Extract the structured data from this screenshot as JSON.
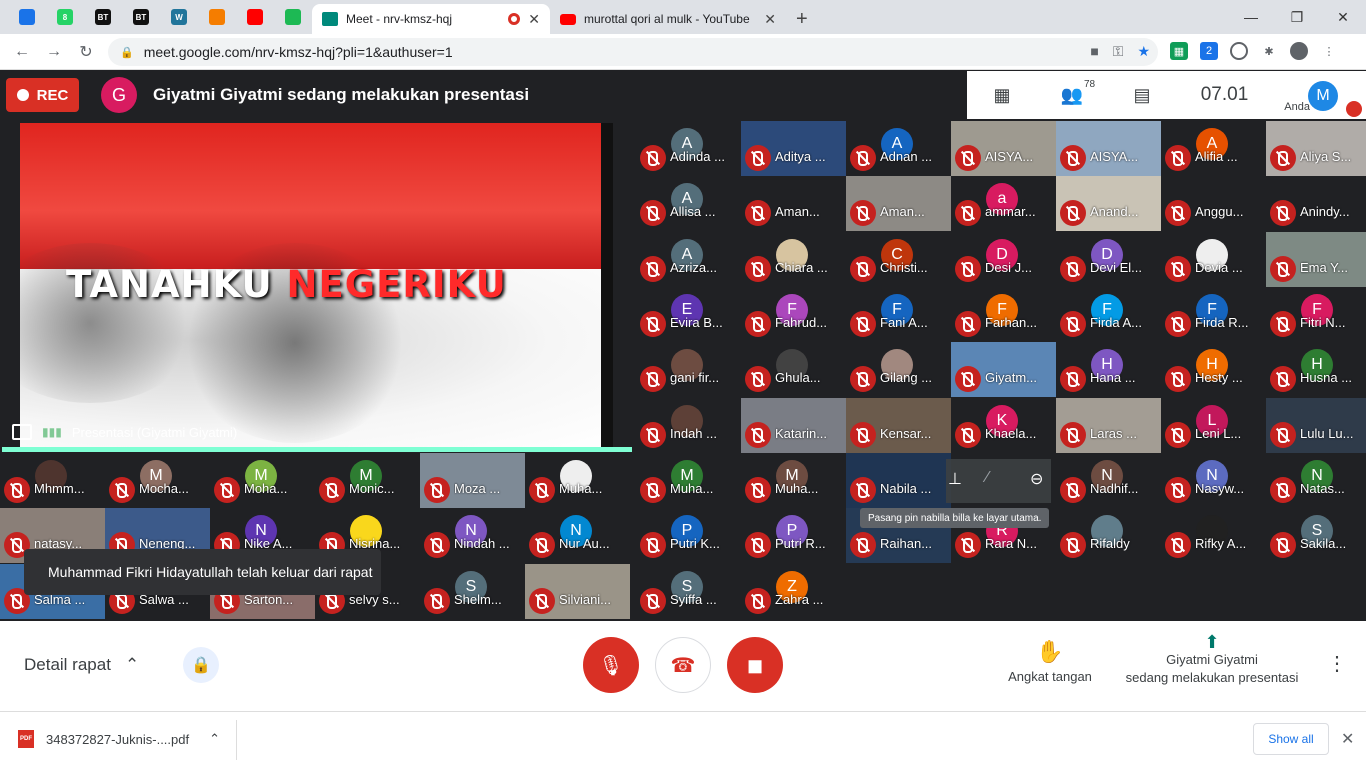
{
  "browser": {
    "pinned_tabs": [
      {
        "icon": "kemdikbud-icon",
        "color": "#1a73e8",
        "label": ""
      },
      {
        "icon": "whatsapp-icon",
        "color": "#25d366",
        "label": "8"
      },
      {
        "icon": "bt-icon",
        "color": "#111111",
        "label": "BT"
      },
      {
        "icon": "bt-icon",
        "color": "#111111",
        "label": "BT"
      },
      {
        "icon": "wordpress-icon",
        "color": "#21759b",
        "label": "W"
      },
      {
        "icon": "blogger-icon",
        "color": "#f57d00",
        "label": ""
      },
      {
        "icon": "youtube-icon",
        "color": "#ff0000",
        "label": ""
      },
      {
        "icon": "spotify-icon",
        "color": "#1db954",
        "label": ""
      }
    ],
    "active_tab_title": "Meet - nrv-kmsz-hqj",
    "second_tab_title": "murottal qori al mulk - YouTube",
    "url": "meet.google.com/nrv-kmsz-hqj?pli=1&authuser=1",
    "profile_initial": ""
  },
  "meet": {
    "rec_label": "REC",
    "presenter_initial": "G",
    "presenter_text": "Giyatmi Giyatmi sedang melakukan presentasi",
    "participant_count": "78",
    "clock": "07.01",
    "me_initial": "M",
    "me_label": "Anda",
    "slide_word1": "TANAHKU",
    "slide_word2": "NEGERIKU",
    "presentation_caption": "Presentasi (Giyatmi Giyatmi)",
    "toast": "Muhammad Fikri Hidayatullah telah keluar dari rapat",
    "pin_tooltip": "Pasang pin nabilla billa ke layar utama."
  },
  "participants": [
    {
      "name": "Adinda ...",
      "initial": "A",
      "color": "#546e7a",
      "bg": ""
    },
    {
      "name": "Aditya ...",
      "initial": "",
      "color": "",
      "bg": "#2c4a7a"
    },
    {
      "name": "Adnan ...",
      "initial": "A",
      "color": "#1565c0",
      "bg": ""
    },
    {
      "name": "AISYA...",
      "initial": "",
      "color": "",
      "bg": "#9e9a90"
    },
    {
      "name": "AISYA...",
      "initial": "",
      "color": "",
      "bg": "#8fa7c0"
    },
    {
      "name": "Alifia ...",
      "initial": "A",
      "color": "#e65100",
      "bg": ""
    },
    {
      "name": "Aliya S...",
      "initial": "",
      "color": "",
      "bg": "#b0aca8"
    },
    {
      "name": "Allisa ...",
      "initial": "A",
      "color": "#546e7a",
      "bg": ""
    },
    {
      "name": "Aman...",
      "initial": "",
      "color": "",
      "bg": ""
    },
    {
      "name": "Aman...",
      "initial": "",
      "color": "",
      "bg": "#8d8a85"
    },
    {
      "name": "ammar...",
      "initial": "a",
      "color": "#d81b60",
      "bg": ""
    },
    {
      "name": "Anand...",
      "initial": "",
      "color": "",
      "bg": "#c9c3b5"
    },
    {
      "name": "Anggu...",
      "initial": "",
      "color": "",
      "bg": ""
    },
    {
      "name": "Anindy...",
      "initial": "",
      "color": "",
      "bg": ""
    },
    {
      "name": "Azriza...",
      "initial": "A",
      "color": "#546e7a",
      "bg": ""
    },
    {
      "name": "Chiara ...",
      "initial": "",
      "color": "#d7c4a0",
      "bg": ""
    },
    {
      "name": "Christi...",
      "initial": "C",
      "color": "#bf360c",
      "bg": ""
    },
    {
      "name": "Desi J...",
      "initial": "D",
      "color": "#d81b60",
      "bg": ""
    },
    {
      "name": "Devi El...",
      "initial": "D",
      "color": "#7e57c2",
      "bg": ""
    },
    {
      "name": "Devia ...",
      "initial": "",
      "color": "#eeeeee",
      "bg": ""
    },
    {
      "name": "Ema Y...",
      "initial": "",
      "color": "",
      "bg": "#7e8a84"
    },
    {
      "name": "Evira B...",
      "initial": "E",
      "color": "#5e35b1",
      "bg": ""
    },
    {
      "name": "Fahrud...",
      "initial": "F",
      "color": "#ab47bc",
      "bg": ""
    },
    {
      "name": "Fani A...",
      "initial": "F",
      "color": "#1565c0",
      "bg": ""
    },
    {
      "name": "Farhan...",
      "initial": "F",
      "color": "#ef6c00",
      "bg": ""
    },
    {
      "name": "Firda A...",
      "initial": "F",
      "color": "#039be5",
      "bg": ""
    },
    {
      "name": "Firda R...",
      "initial": "F",
      "color": "#1565c0",
      "bg": ""
    },
    {
      "name": "Fitri N...",
      "initial": "F",
      "color": "#d81b60",
      "bg": ""
    },
    {
      "name": "gani fir...",
      "initial": "",
      "color": "#6d4c41",
      "bg": ""
    },
    {
      "name": "Ghula...",
      "initial": "",
      "color": "#424242",
      "bg": ""
    },
    {
      "name": "Gilang ...",
      "initial": "",
      "color": "#a1887f",
      "bg": ""
    },
    {
      "name": "Giyatm...",
      "initial": "",
      "color": "",
      "bg": "#5b86b5"
    },
    {
      "name": "Hana ...",
      "initial": "H",
      "color": "#7e57c2",
      "bg": ""
    },
    {
      "name": "Hesty ...",
      "initial": "H",
      "color": "#ef6c00",
      "bg": ""
    },
    {
      "name": "Husna ...",
      "initial": "H",
      "color": "#2e7d32",
      "bg": ""
    },
    {
      "name": "Indah ...",
      "initial": "",
      "color": "#5d4037",
      "bg": ""
    },
    {
      "name": "Katarin...",
      "initial": "",
      "color": "",
      "bg": "#7a7d85"
    },
    {
      "name": "Kensar...",
      "initial": "",
      "color": "",
      "bg": "#6b5b4c"
    },
    {
      "name": "Khaela...",
      "initial": "K",
      "color": "#d81b60",
      "bg": ""
    },
    {
      "name": "Laras ...",
      "initial": "",
      "color": "",
      "bg": "#a39d94"
    },
    {
      "name": "Leni L...",
      "initial": "L",
      "color": "#c2185b",
      "bg": ""
    },
    {
      "name": "Lulu Lu...",
      "initial": "",
      "color": "",
      "bg": "#2f3b4a"
    },
    {
      "name": "Mhmm...",
      "initial": "",
      "color": "#4e342e",
      "bg": ""
    },
    {
      "name": "Mocha...",
      "initial": "M",
      "color": "#8d6e63",
      "bg": ""
    },
    {
      "name": "Moha...",
      "initial": "M",
      "color": "#7cb342",
      "bg": ""
    },
    {
      "name": "Monic...",
      "initial": "M",
      "color": "#2e7d32",
      "bg": ""
    },
    {
      "name": "Moza ...",
      "initial": "",
      "color": "",
      "bg": "#7e8a96"
    },
    {
      "name": "Muha...",
      "initial": "",
      "color": "#eeeeee",
      "bg": ""
    },
    {
      "name": "Muha...",
      "initial": "M",
      "color": "#2e7d32",
      "bg": ""
    },
    {
      "name": "Muha...",
      "initial": "M",
      "color": "#6d4c41",
      "bg": ""
    },
    {
      "name": "Nabila ...",
      "initial": "",
      "color": "",
      "bg": "#1f3553"
    },
    {
      "name": "",
      "initial": "",
      "color": "",
      "bg": ""
    },
    {
      "name": "Nadhif...",
      "initial": "N",
      "color": "#6d4c41",
      "bg": ""
    },
    {
      "name": "Nasyw...",
      "initial": "N",
      "color": "#5c6bc0",
      "bg": ""
    },
    {
      "name": "Natas...",
      "initial": "N",
      "color": "#2e7d32",
      "bg": ""
    },
    {
      "name": "natasy...",
      "initial": "",
      "color": "",
      "bg": "#8a7f78"
    },
    {
      "name": "Neneng...",
      "initial": "",
      "color": "",
      "bg": "#3c5a8a"
    },
    {
      "name": "Nike A...",
      "initial": "N",
      "color": "#5e35b1",
      "bg": ""
    },
    {
      "name": "Nisrina...",
      "initial": "",
      "color": "#f9d71c",
      "bg": ""
    },
    {
      "name": "Nindah ...",
      "initial": "N",
      "color": "#7e57c2",
      "bg": ""
    },
    {
      "name": "Nur Au...",
      "initial": "N",
      "color": "#0288d1",
      "bg": ""
    },
    {
      "name": "Putri K...",
      "initial": "P",
      "color": "#1565c0",
      "bg": ""
    },
    {
      "name": "Putri R...",
      "initial": "P",
      "color": "#7e57c2",
      "bg": ""
    },
    {
      "name": "Raihan...",
      "initial": "",
      "color": "",
      "bg": "#253a55"
    },
    {
      "name": "Rara N...",
      "initial": "R",
      "color": "#d81b60",
      "bg": ""
    },
    {
      "name": "Rifaldy",
      "initial": "",
      "color": "#607d8b",
      "bg": ""
    },
    {
      "name": "Rifky A...",
      "initial": "",
      "color": "#212121",
      "bg": ""
    },
    {
      "name": "Sakila...",
      "initial": "S",
      "color": "#546e7a",
      "bg": ""
    },
    {
      "name": "Salma ...",
      "initial": "",
      "color": "",
      "bg": "#3a6ea5"
    },
    {
      "name": "Salwa ...",
      "initial": "",
      "color": "",
      "bg": ""
    },
    {
      "name": "Sarton...",
      "initial": "",
      "color": "",
      "bg": "#8a6d6a"
    },
    {
      "name": "selvy s...",
      "initial": "",
      "color": "",
      "bg": ""
    },
    {
      "name": "Shelm...",
      "initial": "S",
      "color": "#546e7a",
      "bg": ""
    },
    {
      "name": "Silviani...",
      "initial": "",
      "color": "",
      "bg": "#9a9488"
    },
    {
      "name": "Syiffa ...",
      "initial": "S",
      "color": "#546e7a",
      "bg": ""
    },
    {
      "name": "Zahra ...",
      "initial": "Z",
      "color": "#ef6c00",
      "bg": ""
    }
  ],
  "controls": {
    "details_label": "Detail rapat",
    "raise_hand_label": "Angkat tangan",
    "presenting_line1": "Giyatmi Giyatmi",
    "presenting_line2": "sedang melakukan presentasi"
  },
  "downloads": {
    "file_name": "348372827-Juknis-....pdf",
    "file_badge": "PDF",
    "show_all": "Show all"
  }
}
